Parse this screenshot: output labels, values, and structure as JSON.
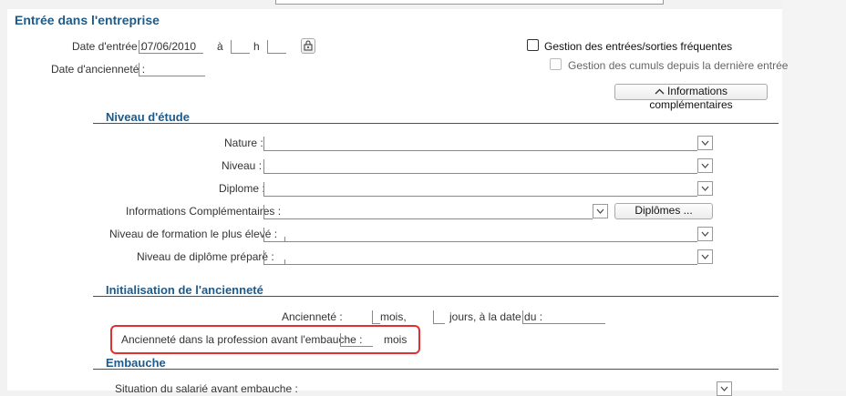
{
  "section_entree": {
    "title": "Entrée dans l'entreprise"
  },
  "date_entree": {
    "label": "Date d'entrée :",
    "value": "07/06/2010",
    "a_label": "à",
    "h_label": "h"
  },
  "date_anciennete": {
    "label": "Date d'ancienneté :",
    "value": ""
  },
  "gestion_es": {
    "label": "Gestion des entrées/sorties fréquentes"
  },
  "gestion_cumuls": {
    "label": "Gestion des cumuls depuis la dernière entrée"
  },
  "info_comp_button": {
    "label": "Informations complémentaires",
    "icon": "chevron-up-icon"
  },
  "niveau_etude": {
    "title": "Niveau d'étude",
    "nature_label": "Nature :",
    "niveau_label": "Niveau :",
    "diplome_label": "Diplome :",
    "info_comp_label": "Informations Complémentaires :",
    "diplomes_button": "Diplômes ...",
    "formation_label": "Niveau de formation le plus élevé :",
    "diplome_prepare_label": "Niveau de diplôme préparé :"
  },
  "init_anciennete": {
    "title": "Initialisation de l'ancienneté",
    "anciennete_label": "Ancienneté :",
    "mois_label": "mois,",
    "jours_label": "jours, à la date du :",
    "profession_label": "Ancienneté dans la profession avant l'embauche :",
    "profession_unit": "mois"
  },
  "embauche": {
    "title": "Embauche",
    "situation_label": "Situation du salarié avant embauche :"
  },
  "colors": {
    "accent": "#1e5a8a",
    "highlight": "#e23030"
  }
}
